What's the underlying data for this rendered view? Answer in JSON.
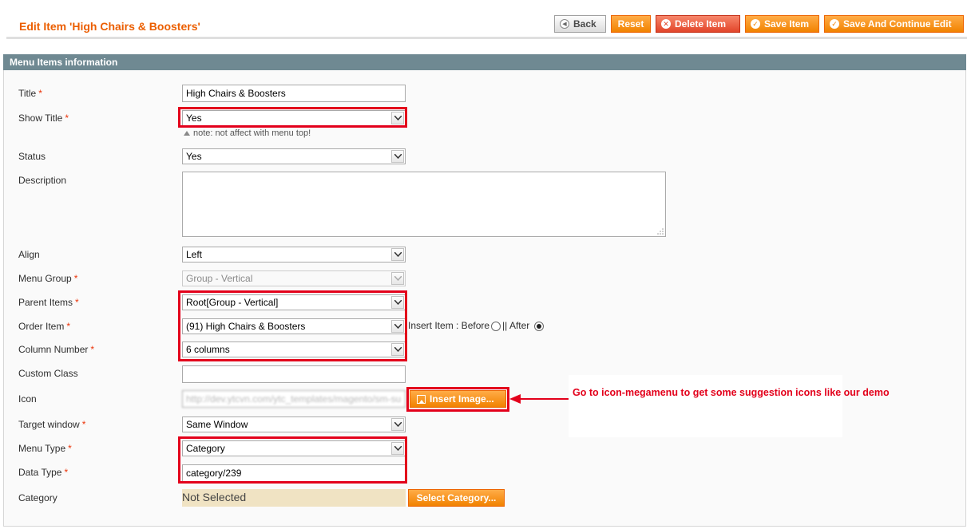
{
  "header": {
    "title": "Edit Item 'High Chairs & Boosters'",
    "buttons": {
      "back": "Back",
      "reset": "Reset",
      "delete": "Delete Item",
      "save": "Save Item",
      "save_continue": "Save And Continue Edit"
    }
  },
  "section": {
    "title": "Menu Items information"
  },
  "form": {
    "title": {
      "label": "Title",
      "value": "High Chairs & Boosters"
    },
    "show_title": {
      "label": "Show Title",
      "value": "Yes",
      "note": "note: not affect with menu top!"
    },
    "status": {
      "label": "Status",
      "value": "Yes"
    },
    "description": {
      "label": "Description",
      "value": ""
    },
    "align": {
      "label": "Align",
      "value": "Left"
    },
    "menu_group": {
      "label": "Menu Group",
      "value": "Group - Vertical"
    },
    "parent_items": {
      "label": "Parent Items",
      "value": "Root[Group - Vertical]"
    },
    "order_item": {
      "label": "Order Item",
      "value": "(91) High Chairs & Boosters",
      "insert_label": "Insert Item : Before",
      "separator": "|| After"
    },
    "column_number": {
      "label": "Column Number",
      "value": "6 columns"
    },
    "custom_class": {
      "label": "Custom Class",
      "value": ""
    },
    "icon": {
      "label": "Icon",
      "value": "http://dev.ytcvn.com/ytc_templates/magento/sm-su",
      "button": "Insert Image..."
    },
    "target_window": {
      "label": "Target window",
      "value": "Same Window"
    },
    "menu_type": {
      "label": "Menu Type",
      "value": "Category"
    },
    "data_type": {
      "label": "Data Type",
      "value": "category/239"
    },
    "category": {
      "label": "Category",
      "value": "Not Selected",
      "button": "Select Category..."
    },
    "required_mark": "*"
  },
  "annotation": {
    "text": "Go to icon-megamenu to get some suggestion icons like our demo"
  },
  "colors": {
    "accent": "#eb5e00",
    "button_orange": "#f18200",
    "header_bar": "#6f8992",
    "highlight_red": "#e3001b"
  }
}
